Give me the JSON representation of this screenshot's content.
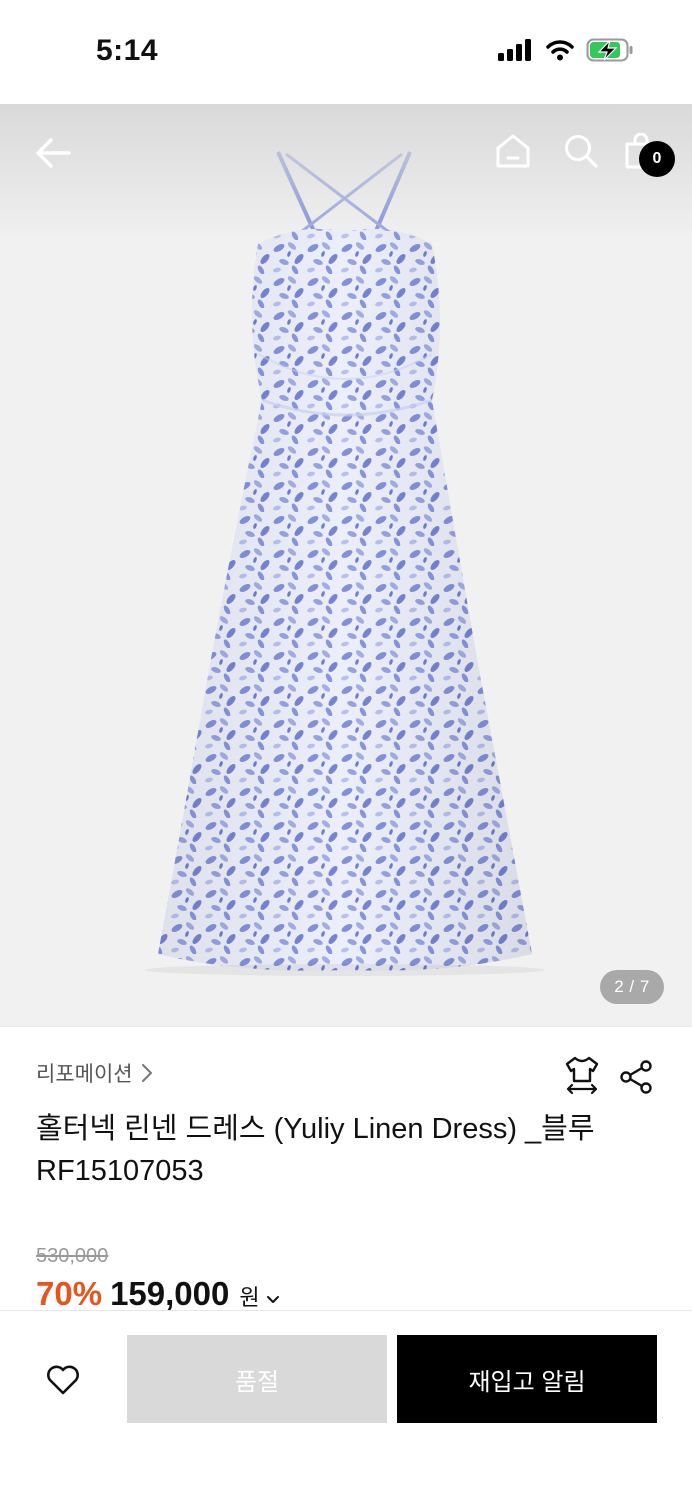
{
  "status_bar": {
    "time": "5:14"
  },
  "header": {
    "cart_count": "0"
  },
  "gallery": {
    "page_indicator": "2 / 7",
    "current_page": 2,
    "total_pages": 7
  },
  "product": {
    "brand": "리포메이션",
    "title": "홀터넥 린넨 드레스 (Yuliy Linen Dress) _블루 RF15107053",
    "original_price": "530,000",
    "discount": "70%",
    "sale_price": "159,000",
    "currency": "원"
  },
  "bottom_bar": {
    "soldout_label": "품절",
    "restock_label": "재입고 알림"
  },
  "colors": {
    "accent": "#e8541e",
    "dress_blue": "#7f8ede",
    "dark": "#000000"
  }
}
